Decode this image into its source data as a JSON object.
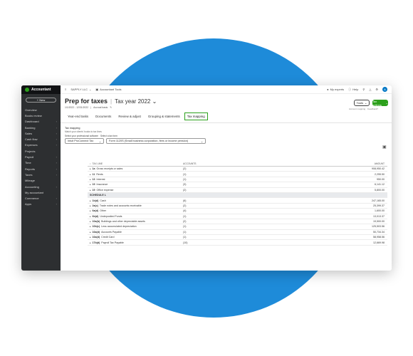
{
  "colors": {
    "brand_green": "#2ca01c",
    "blue_circle": "#1e8bd9",
    "sidebar": "#2d2f31",
    "accent_blue": "#0077c5"
  },
  "sidebar": {
    "brand": "Accountant",
    "new_button": "+ New",
    "items": [
      {
        "label": "Overview",
        "chevron": false
      },
      {
        "label": "Books review",
        "chevron": false
      },
      {
        "label": "Dashboard",
        "chevron": true
      },
      {
        "label": "Banking",
        "chevron": true
      },
      {
        "label": "Sales",
        "chevron": true
      },
      {
        "label": "Cash flow",
        "chevron": true
      },
      {
        "label": "Expenses",
        "chevron": true
      },
      {
        "label": "Projects",
        "chevron": false
      },
      {
        "label": "Payroll",
        "chevron": true
      },
      {
        "label": "Time",
        "chevron": true
      },
      {
        "label": "Reports",
        "chevron": true
      },
      {
        "label": "Taxes",
        "chevron": true
      },
      {
        "label": "Mileage",
        "chevron": false
      },
      {
        "label": "Accounting",
        "chevron": true
      },
      {
        "label": "My accountant",
        "chevron": false
      },
      {
        "label": "Commerce",
        "chevron": true
      },
      {
        "label": "Apps",
        "chevron": true
      }
    ]
  },
  "topbar": {
    "company": "SAPPLY LLC",
    "toolbox": "Accountant Tools",
    "my_experts": "My experts",
    "help": "Help",
    "avatar_letter": "A"
  },
  "header": {
    "title": "Prep for taxes",
    "tax_year": "Tax year 2022",
    "date_range": "1/1/2022 - 12/31/2022",
    "accrual": "Accrual basis",
    "tools_button": "Tools",
    "tax_options_button": "Tax options",
    "account_link": "Account mapping",
    "feedback_link": "Feedback?"
  },
  "tabs": [
    "Year-end tasks",
    "Documents",
    "Review & adjust",
    "Grouping & statements",
    "Tax mapping"
  ],
  "active_tab": "Tax mapping",
  "mapping": {
    "title": "Tax mapping",
    "subtitle": "Match your clients' books to tax lines",
    "software_label": "Select your professional software",
    "form_label": "Select a tax form",
    "software_value": "Intuit ProConnect Tax",
    "form_value": "Form 1120S (Small business corporation, fees or income pension)"
  },
  "table": {
    "headers": [
      "TAX LINE",
      "ACCOUNTS",
      "AMOUNT"
    ],
    "rows": [
      {
        "line": "1a",
        "name": "Gross receipts or sales",
        "accounts": "(2)",
        "amount": "908,950.42",
        "section": false
      },
      {
        "line": "11",
        "name": "Rents",
        "accounts": "(1)",
        "amount": "2,255.50",
        "section": false
      },
      {
        "line": "13",
        "name": "Interest",
        "accounts": "(1)",
        "amount": "950.00",
        "section": false
      },
      {
        "line": "19",
        "name": "Insurance",
        "accounts": "(3)",
        "amount": "6,141.12",
        "section": false
      },
      {
        "line": "19",
        "name": "Office expense",
        "accounts": "(2)",
        "amount": "5,800.00",
        "section": false
      },
      {
        "line": "",
        "name": "SCHEDULE L",
        "accounts": "",
        "amount": "",
        "section": true
      },
      {
        "line": "1b(d)",
        "name": "Cash",
        "accounts": "(6)",
        "amount": "247,165.00",
        "section": false
      },
      {
        "line": "2a(c)",
        "name": "Trade notes and accounts receivable",
        "accounts": "(2)",
        "amount": "25,399.37",
        "section": false
      },
      {
        "line": "6a(d)",
        "name": "Other",
        "accounts": "(4)",
        "amount": "1,600.00",
        "section": false
      },
      {
        "line": "6b(d)",
        "name": "Undeposited Funds",
        "accounts": "(1)",
        "amount": "13,013.37",
        "section": false
      },
      {
        "line": "10a(b)",
        "name": "Buildings and other depreciable assets",
        "accounts": "(2)",
        "amount": "19,500.00",
        "section": false
      },
      {
        "line": "10b(c)",
        "name": "Less accumulated depreciation",
        "accounts": "(1)",
        "amount": "125,503.56",
        "section": false
      },
      {
        "line": "16a(d)",
        "name": "Accounts Payable",
        "accounts": "(1)",
        "amount": "50,734.34",
        "section": false
      },
      {
        "line": "16a(d)",
        "name": "Credit Card",
        "accounts": "(1)",
        "amount": "58,958.56",
        "section": false
      },
      {
        "line": "17b(d)",
        "name": "Payroll Tax Payable",
        "accounts": "(10)",
        "amount": "12,669.98",
        "section": false
      }
    ]
  }
}
